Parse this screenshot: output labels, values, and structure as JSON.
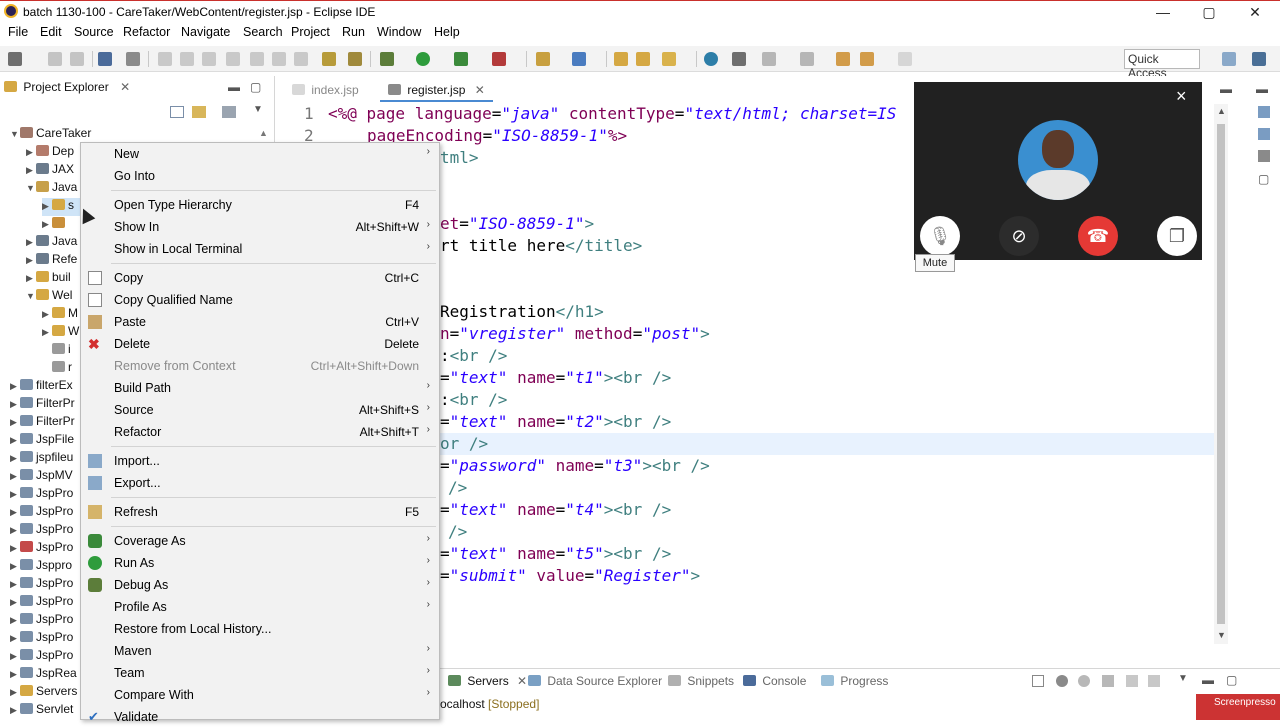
{
  "window": {
    "title": "batch 1130-100 - CareTaker/WebContent/register.jsp - Eclipse IDE",
    "minimize": "—",
    "maximize": "▢",
    "close": "✕"
  },
  "menubar": [
    "File",
    "Edit",
    "Source",
    "Refactor",
    "Navigate",
    "Search",
    "Project",
    "Run",
    "Window",
    "Help"
  ],
  "toolbar": {
    "quick_access": "Quick Access"
  },
  "explorer": {
    "title": "Project Explorer",
    "rows": [
      {
        "label": "CareTaker",
        "expanded": true
      },
      {
        "label": "Dep",
        "expanded": false
      },
      {
        "label": "JAX",
        "expanded": false
      },
      {
        "label": "Java",
        "expanded": true
      },
      {
        "label": "s",
        "expanded": false
      },
      {
        "label": "",
        "expanded": false
      },
      {
        "label": "Java",
        "expanded": false
      },
      {
        "label": "Refe",
        "expanded": false
      },
      {
        "label": "buil",
        "expanded": false
      },
      {
        "label": "Wel",
        "expanded": true
      },
      {
        "label": "M",
        "expanded": false
      },
      {
        "label": "W",
        "expanded": false
      },
      {
        "label": "i",
        "expanded": false
      },
      {
        "label": "r",
        "expanded": false
      },
      {
        "label": "filterEx",
        "expanded": false
      },
      {
        "label": "FilterPr",
        "expanded": false
      },
      {
        "label": "FilterPr",
        "expanded": false
      },
      {
        "label": "JspFile",
        "expanded": false
      },
      {
        "label": "jspfileu",
        "expanded": false
      },
      {
        "label": "JspMV",
        "expanded": false
      },
      {
        "label": "JspPro",
        "expanded": false
      },
      {
        "label": "JspPro",
        "expanded": false
      },
      {
        "label": "JspPro",
        "expanded": false
      },
      {
        "label": "JspPro",
        "expanded": false
      },
      {
        "label": "Jsppro",
        "expanded": false
      },
      {
        "label": "JspPro",
        "expanded": false
      },
      {
        "label": "JspPro",
        "expanded": false
      },
      {
        "label": "JspPro",
        "expanded": false
      },
      {
        "label": "JspPro",
        "expanded": false
      },
      {
        "label": "JspPro",
        "expanded": false
      },
      {
        "label": "JspRea",
        "expanded": false
      },
      {
        "label": "Servers",
        "expanded": false
      },
      {
        "label": "Servlet",
        "expanded": false
      }
    ]
  },
  "editor": {
    "tabs": [
      {
        "label": "index.jsp",
        "active": false
      },
      {
        "label": "register.jsp",
        "active": true
      }
    ],
    "line_numbers": [
      "1",
      "2"
    ],
    "code": {
      "l1_a": "<%@ ",
      "l1_b": "page ",
      "l1_c": "language",
      "l1_d": "=",
      "l1_e": "\"java\"",
      "l1_f": " contentType",
      "l1_g": "=",
      "l1_h": "\"text/html; charset=IS",
      "l2_a": "pageEncoding",
      "l2_b": "=",
      "l2_c": "\"ISO-8859-1\"",
      "l2_d": "%>",
      "l3": "tml>",
      "l4_a": "et",
      "l4_b": "=",
      "l4_c": "\"ISO-8859-1\"",
      "l4_d": ">",
      "l5_a": "rt title here",
      "l5_b": "</title>",
      "l6_a": "Registration",
      "l6_b": "</h1>",
      "l7_a": "n",
      "l7_b": "=",
      "l7_c": "\"vregister\"",
      "l7_d": " method",
      "l7_e": "=",
      "l7_f": "\"post\"",
      "l7_g": ">",
      "l8_a": ":",
      "l8_b": "<br />",
      "l9_a": "=",
      "l9_b": "\"text\"",
      "l9_c": " name",
      "l9_d": "=",
      "l9_e": "\"t1\"",
      "l9_f": "><br />",
      "l10_a": ":",
      "l10_b": "<br />",
      "l11_a": "=",
      "l11_b": "\"text\"",
      "l11_c": " name",
      "l11_d": "=",
      "l11_e": "\"t2\"",
      "l11_f": "><br />",
      "l12": "or />",
      "l13_a": "=",
      "l13_b": "\"password\"",
      "l13_c": " name",
      "l13_d": "=",
      "l13_e": "\"t3\"",
      "l13_f": "><br />",
      "l14": "/>",
      "l15_a": "=",
      "l15_b": "\"text\"",
      "l15_c": " name",
      "l15_d": "=",
      "l15_e": "\"t4\"",
      "l15_f": "><br />",
      "l16": "/>",
      "l17_a": "=",
      "l17_b": "\"text\"",
      "l17_c": " name",
      "l17_d": "=",
      "l17_e": "\"t5\"",
      "l17_f": "><br />",
      "l18_a": "=",
      "l18_b": "\"submit\"",
      "l18_c": " value",
      "l18_d": "=",
      "l18_e": "\"Register\"",
      "l18_f": ">"
    }
  },
  "bottom_panel": {
    "tabs": [
      "Servers",
      "Data Source Explorer",
      "Snippets",
      "Console",
      "Progress"
    ],
    "server_row": "ocalhost",
    "server_status": " [Stopped]"
  },
  "context_menu": {
    "items": [
      {
        "label": "New",
        "shortcut": "",
        "submenu": true,
        "icon": ""
      },
      {
        "label": "Go Into",
        "shortcut": "",
        "submenu": false,
        "icon": ""
      },
      {
        "label": "Open Type Hierarchy",
        "shortcut": "F4",
        "submenu": false,
        "icon": ""
      },
      {
        "label": "Show In",
        "shortcut": "Alt+Shift+W",
        "submenu": true,
        "icon": ""
      },
      {
        "label": "Show in Local Terminal",
        "shortcut": "",
        "submenu": true,
        "icon": ""
      },
      {
        "label": "Copy",
        "shortcut": "Ctrl+C",
        "submenu": false,
        "icon": "copy-icon"
      },
      {
        "label": "Copy Qualified Name",
        "shortcut": "",
        "submenu": false,
        "icon": "copy-icon"
      },
      {
        "label": "Paste",
        "shortcut": "Ctrl+V",
        "submenu": false,
        "icon": "paste-icon"
      },
      {
        "label": "Delete",
        "shortcut": "Delete",
        "submenu": false,
        "icon": "delete-icon"
      },
      {
        "label": "Remove from Context",
        "shortcut": "Ctrl+Alt+Shift+Down",
        "submenu": false,
        "icon": "",
        "disabled": true
      },
      {
        "label": "Build Path",
        "shortcut": "",
        "submenu": true,
        "icon": ""
      },
      {
        "label": "Source",
        "shortcut": "Alt+Shift+S",
        "submenu": true,
        "icon": ""
      },
      {
        "label": "Refactor",
        "shortcut": "Alt+Shift+T",
        "submenu": true,
        "icon": ""
      },
      {
        "label": "Import...",
        "shortcut": "",
        "submenu": false,
        "icon": "import-icon"
      },
      {
        "label": "Export...",
        "shortcut": "",
        "submenu": false,
        "icon": "export-icon"
      },
      {
        "label": "Refresh",
        "shortcut": "F5",
        "submenu": false,
        "icon": "refresh-icon"
      },
      {
        "label": "Coverage As",
        "shortcut": "",
        "submenu": true,
        "icon": "coverage-icon"
      },
      {
        "label": "Run As",
        "shortcut": "",
        "submenu": true,
        "icon": "run-icon"
      },
      {
        "label": "Debug As",
        "shortcut": "",
        "submenu": true,
        "icon": "debug-icon"
      },
      {
        "label": "Profile As",
        "shortcut": "",
        "submenu": true,
        "icon": ""
      },
      {
        "label": "Restore from Local History...",
        "shortcut": "",
        "submenu": false,
        "icon": ""
      },
      {
        "label": "Maven",
        "shortcut": "",
        "submenu": true,
        "icon": ""
      },
      {
        "label": "Team",
        "shortcut": "",
        "submenu": true,
        "icon": ""
      },
      {
        "label": "Compare With",
        "shortcut": "",
        "submenu": true,
        "icon": ""
      },
      {
        "label": "Validate",
        "shortcut": "",
        "submenu": false,
        "icon": "check-icon"
      }
    ]
  },
  "video_call": {
    "close": "×",
    "tooltip": "Mute"
  },
  "watermark": "Screenpresso",
  "colors": {
    "keyword": "#7f0055",
    "string": "#2a00ff",
    "tag": "#3f7f7f",
    "hangup": "#e53935"
  }
}
